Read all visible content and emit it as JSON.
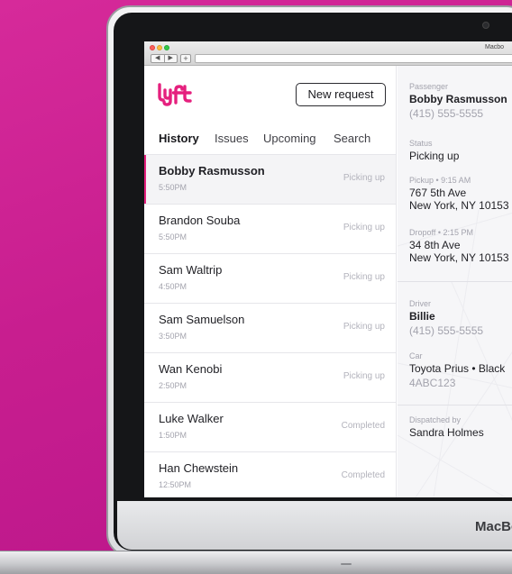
{
  "device": {
    "brand": "MacBo"
  },
  "window": {
    "title": "Macbo",
    "nav_back": "◀",
    "nav_forward": "▶",
    "new_tab": "+"
  },
  "app": {
    "logo": "lyft",
    "accent": "#E5207E",
    "new_request_label": "New request",
    "tabs": [
      "History",
      "Issues",
      "Upcoming",
      "Search"
    ],
    "active_tab": "History",
    "rides": [
      {
        "name": "Bobby Rasmusson",
        "time": "5:50PM",
        "status": "Picking up",
        "selected": true
      },
      {
        "name": "Brandon Souba",
        "time": "5:50PM",
        "status": "Picking up"
      },
      {
        "name": "Sam Waltrip",
        "time": "4:50PM",
        "status": "Picking up"
      },
      {
        "name": "Sam Samuelson",
        "time": "3:50PM",
        "status": "Picking up"
      },
      {
        "name": "Wan Kenobi",
        "time": "2:50PM",
        "status": "Picking up"
      },
      {
        "name": "Luke Walker",
        "time": "1:50PM",
        "status": "Completed"
      },
      {
        "name": "Han Chewstein",
        "time": "12:50PM",
        "status": "Completed"
      }
    ]
  },
  "details": {
    "passenger_label": "Passenger",
    "passenger_name": "Bobby Rasmusson",
    "passenger_phone": "(415) 555-5555",
    "status_label": "Status",
    "status_value": "Picking up",
    "pickup_label": "Pickup • 9:15 AM",
    "pickup_line1": "767 5th Ave",
    "pickup_line2": "New York, NY 10153",
    "dropoff_label": "Dropoff • 2:15 PM",
    "dropoff_line1": "34 8th Ave",
    "dropoff_line2": "New York, NY 10153",
    "driver_label": "Driver",
    "driver_name": "Billie",
    "driver_phone": "(415) 555-5555",
    "car_label": "Car",
    "car_model": "Toyota Prius • Black",
    "car_plate": "4ABC123",
    "dispatched_label": "Dispatched by",
    "dispatched_by": "Sandra Holmes"
  }
}
